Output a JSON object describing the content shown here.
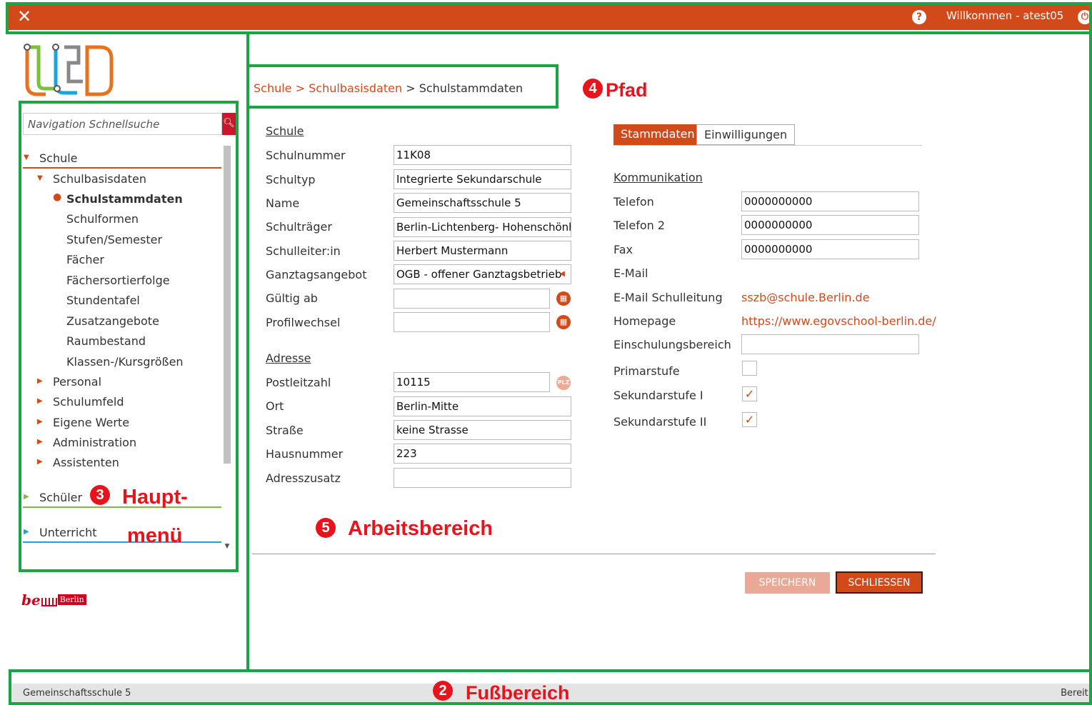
{
  "topbar": {
    "close_icon": "close-icon",
    "help_icon": "help-icon",
    "welcome": "Willkommen - atest05",
    "power_icon": "power-icon",
    "color": "#d24a1a"
  },
  "sidebar": {
    "search_placeholder": "Navigation Schnellsuche",
    "search_icon": "search-icon",
    "items": [
      {
        "label": "Schule",
        "expanded": true
      },
      {
        "label": "Schulbasisdaten",
        "expanded": true
      },
      {
        "label": "Schulstammdaten",
        "active": true
      },
      {
        "label": "Schulformen"
      },
      {
        "label": "Stufen/Semester"
      },
      {
        "label": "Fächer"
      },
      {
        "label": "Fächersortierfolge"
      },
      {
        "label": "Stundentafel"
      },
      {
        "label": "Zusatzangebote"
      },
      {
        "label": "Raumbestand"
      },
      {
        "label": "Klassen-/Kursgrößen"
      },
      {
        "label": "Personal"
      },
      {
        "label": "Schulumfeld"
      },
      {
        "label": "Eigene Werte"
      },
      {
        "label": "Administration"
      },
      {
        "label": "Assistenten"
      },
      {
        "label": "Schüler"
      },
      {
        "label": "Unterricht"
      }
    ],
    "berlin_logo_text": "Berlin"
  },
  "breadcrumb": {
    "items": [
      "Schule",
      "Schulbasisdaten",
      "Schulstammdaten"
    ],
    "separator": ">"
  },
  "form_left": {
    "section_schule": "Schule",
    "fields": [
      {
        "label": "Schulnummer",
        "value": "11K08"
      },
      {
        "label": "Schultyp",
        "value": "Integrierte Sekundarschule"
      },
      {
        "label": "Name",
        "value": "Gemeinschaftsschule 5"
      },
      {
        "label": "Schulträger",
        "value": "Berlin-Lichtenberg- Hohenschönhausen"
      },
      {
        "label": "Schulleiter:in",
        "value": "Herbert Mustermann"
      },
      {
        "label": "Ganztagsangebot",
        "value": "OGB - offener Ganztagsbetrieb"
      },
      {
        "label": "Gültig ab",
        "value": ""
      },
      {
        "label": "Profilwechsel",
        "value": ""
      }
    ],
    "section_adresse": "Adresse",
    "address": [
      {
        "label": "Postleitzahl",
        "value": "10115"
      },
      {
        "label": "Ort",
        "value": "Berlin-Mitte"
      },
      {
        "label": "Straße",
        "value": "keine Strasse"
      },
      {
        "label": "Hausnummer",
        "value": "223"
      },
      {
        "label": "Adresszusatz",
        "value": ""
      }
    ],
    "plz_icon_text": "PLZ"
  },
  "form_right": {
    "tabs": [
      {
        "label": "Stammdaten",
        "active": true
      },
      {
        "label": "Einwilligungen",
        "active": false
      }
    ],
    "section_kommunikation": "Kommunikation",
    "fields": [
      {
        "label": "Telefon",
        "value": "0000000000"
      },
      {
        "label": "Telefon 2",
        "value": "0000000000"
      },
      {
        "label": "Fax",
        "value": "0000000000"
      },
      {
        "label": "E-Mail",
        "value": ""
      },
      {
        "label": "E-Mail Schulleitung",
        "value": "sszb@schule.Berlin.de"
      },
      {
        "label": "Homepage",
        "value": "https://www.egovschool-berlin.de/"
      },
      {
        "label": "Einschulungsbereich",
        "value": ""
      }
    ],
    "checkboxes": [
      {
        "label": "Primarstufe",
        "checked": false
      },
      {
        "label": "Sekundarstufe I",
        "checked": true
      },
      {
        "label": "Sekundarstufe II",
        "checked": true
      }
    ]
  },
  "actions": {
    "save": "SPEICHERN",
    "close": "SCHLIESSEN"
  },
  "footer": {
    "school": "Gemeinschaftsschule 5",
    "status": "Bereit!"
  },
  "annotations": {
    "path_num": "4",
    "path_label": "Pfad",
    "menu_num": "3",
    "menu_label_1": "Haupt-",
    "menu_label_2": "menü",
    "work_num": "5",
    "work_label": "Arbeitsbereich",
    "foot_num": "2",
    "foot_label": "Fußbereich",
    "frame_color": "#17a641",
    "label_color": "#e8141c"
  }
}
